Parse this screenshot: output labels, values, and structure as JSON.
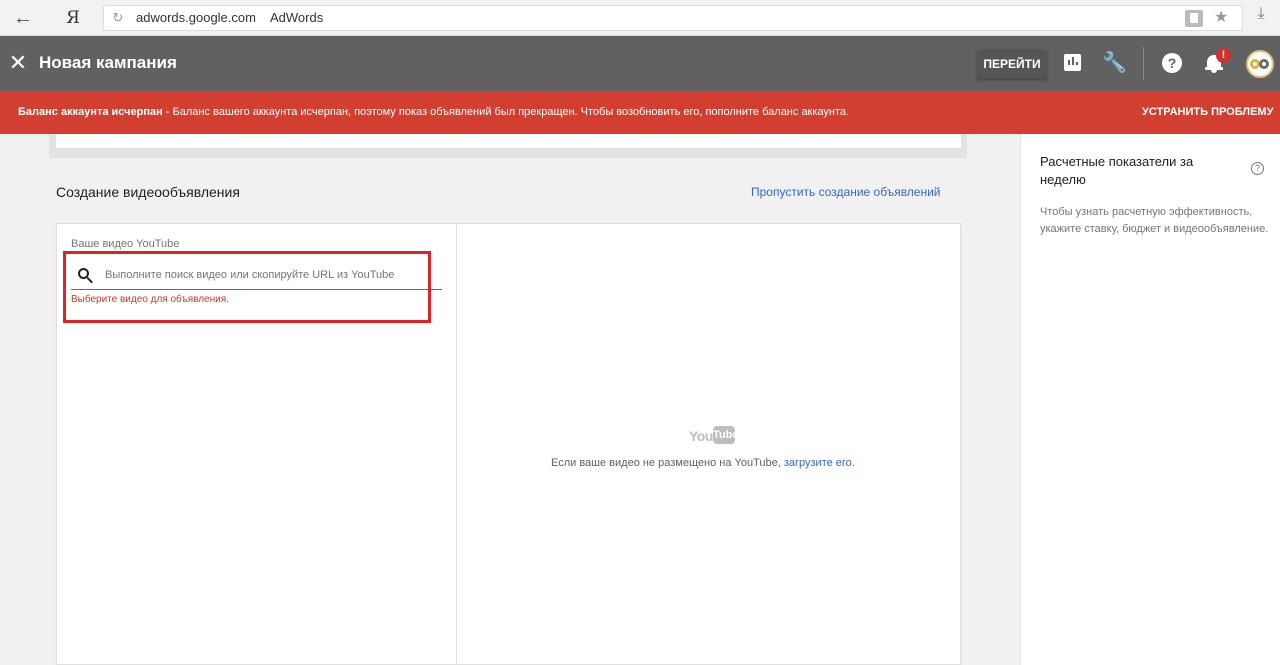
{
  "browser": {
    "back_icon": "arrow-left-icon",
    "yandex_label": "Я",
    "url": "adwords.google.com",
    "page_title": "AdWords",
    "icons": [
      "reload-icon",
      "lock-icon",
      "star-icon",
      "download-icon"
    ]
  },
  "header": {
    "close_icon": "close-icon",
    "title": "Новая кампания",
    "goto_label": "ПЕРЕЙТИ",
    "icons": [
      "chart-icon",
      "wrench-icon",
      "help-icon",
      "bell-icon"
    ],
    "notification_badge": "!"
  },
  "alert": {
    "bold_text": "Баланс аккаунта исчерпан",
    "text": " - Баланс вашего аккаунта исчерпан, поэтому показ объявлений был прекращен. Чтобы возобновить его, пополните баланс аккаунта.",
    "action_label": "УСТРАНИТЬ ПРОБЛЕМУ",
    "color": "#d23f31"
  },
  "main": {
    "section_title": "Создание видеообъявления",
    "skip_link": "Пропустить создание объявлений",
    "video_field": {
      "label": "Ваше видео YouTube",
      "placeholder": "Выполните поиск видео или скопируйте URL из YouTube",
      "value": "",
      "error": "Выберите видео для объявления."
    },
    "preview": {
      "logo_you": "You",
      "logo_tube": "Tube",
      "upload_prefix": "Если ваше видео не размещено на YouTube, ",
      "upload_link": "загрузите его",
      "upload_suffix": "."
    }
  },
  "sidebar": {
    "title": "Расчетные показатели за неделю",
    "description": "Чтобы узнать расчетную эффективность, укажите ставку, бюджет и видеообъявление."
  },
  "colors": {
    "header_bg": "#616161",
    "link": "#3367d6",
    "error": "#c53929",
    "highlight": "#e02222"
  }
}
